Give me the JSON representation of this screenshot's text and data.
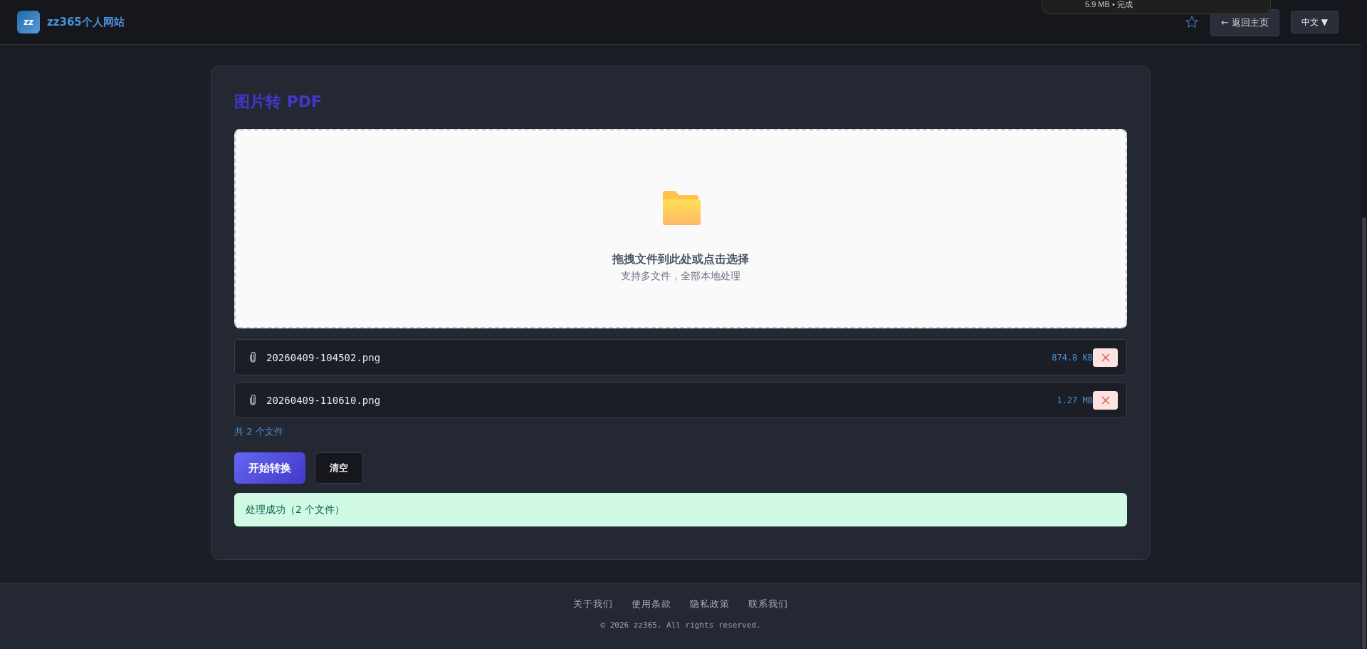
{
  "header": {
    "logo": "zz",
    "brand": "zz365个人网站",
    "back_button": "← 返回主页",
    "language_button": "中文 ▼"
  },
  "download_popup": {
    "status": "5.9 MB • 完成"
  },
  "tool": {
    "title": "图片转 PDF",
    "dropzone": {
      "title": "拖拽文件到此处或点击选择",
      "hint": "支持多文件，全部本地处理"
    },
    "files": [
      {
        "name": "20260409-104502.png",
        "size": "874.8 KB"
      },
      {
        "name": "20260409-110610.png",
        "size": "1.27 MB"
      }
    ],
    "file_count": "共 2 个文件",
    "buttons": [
      {
        "label": "开始转换",
        "kind": "primary"
      },
      {
        "label": "清空",
        "kind": "secondary"
      }
    ],
    "message": "处理成功（2 个文件）"
  },
  "footer": {
    "links": [
      "关于我们",
      "使用条款",
      "隐私政策",
      "联系我们"
    ],
    "copyright": "© 2026 zz365. All rights reserved."
  }
}
